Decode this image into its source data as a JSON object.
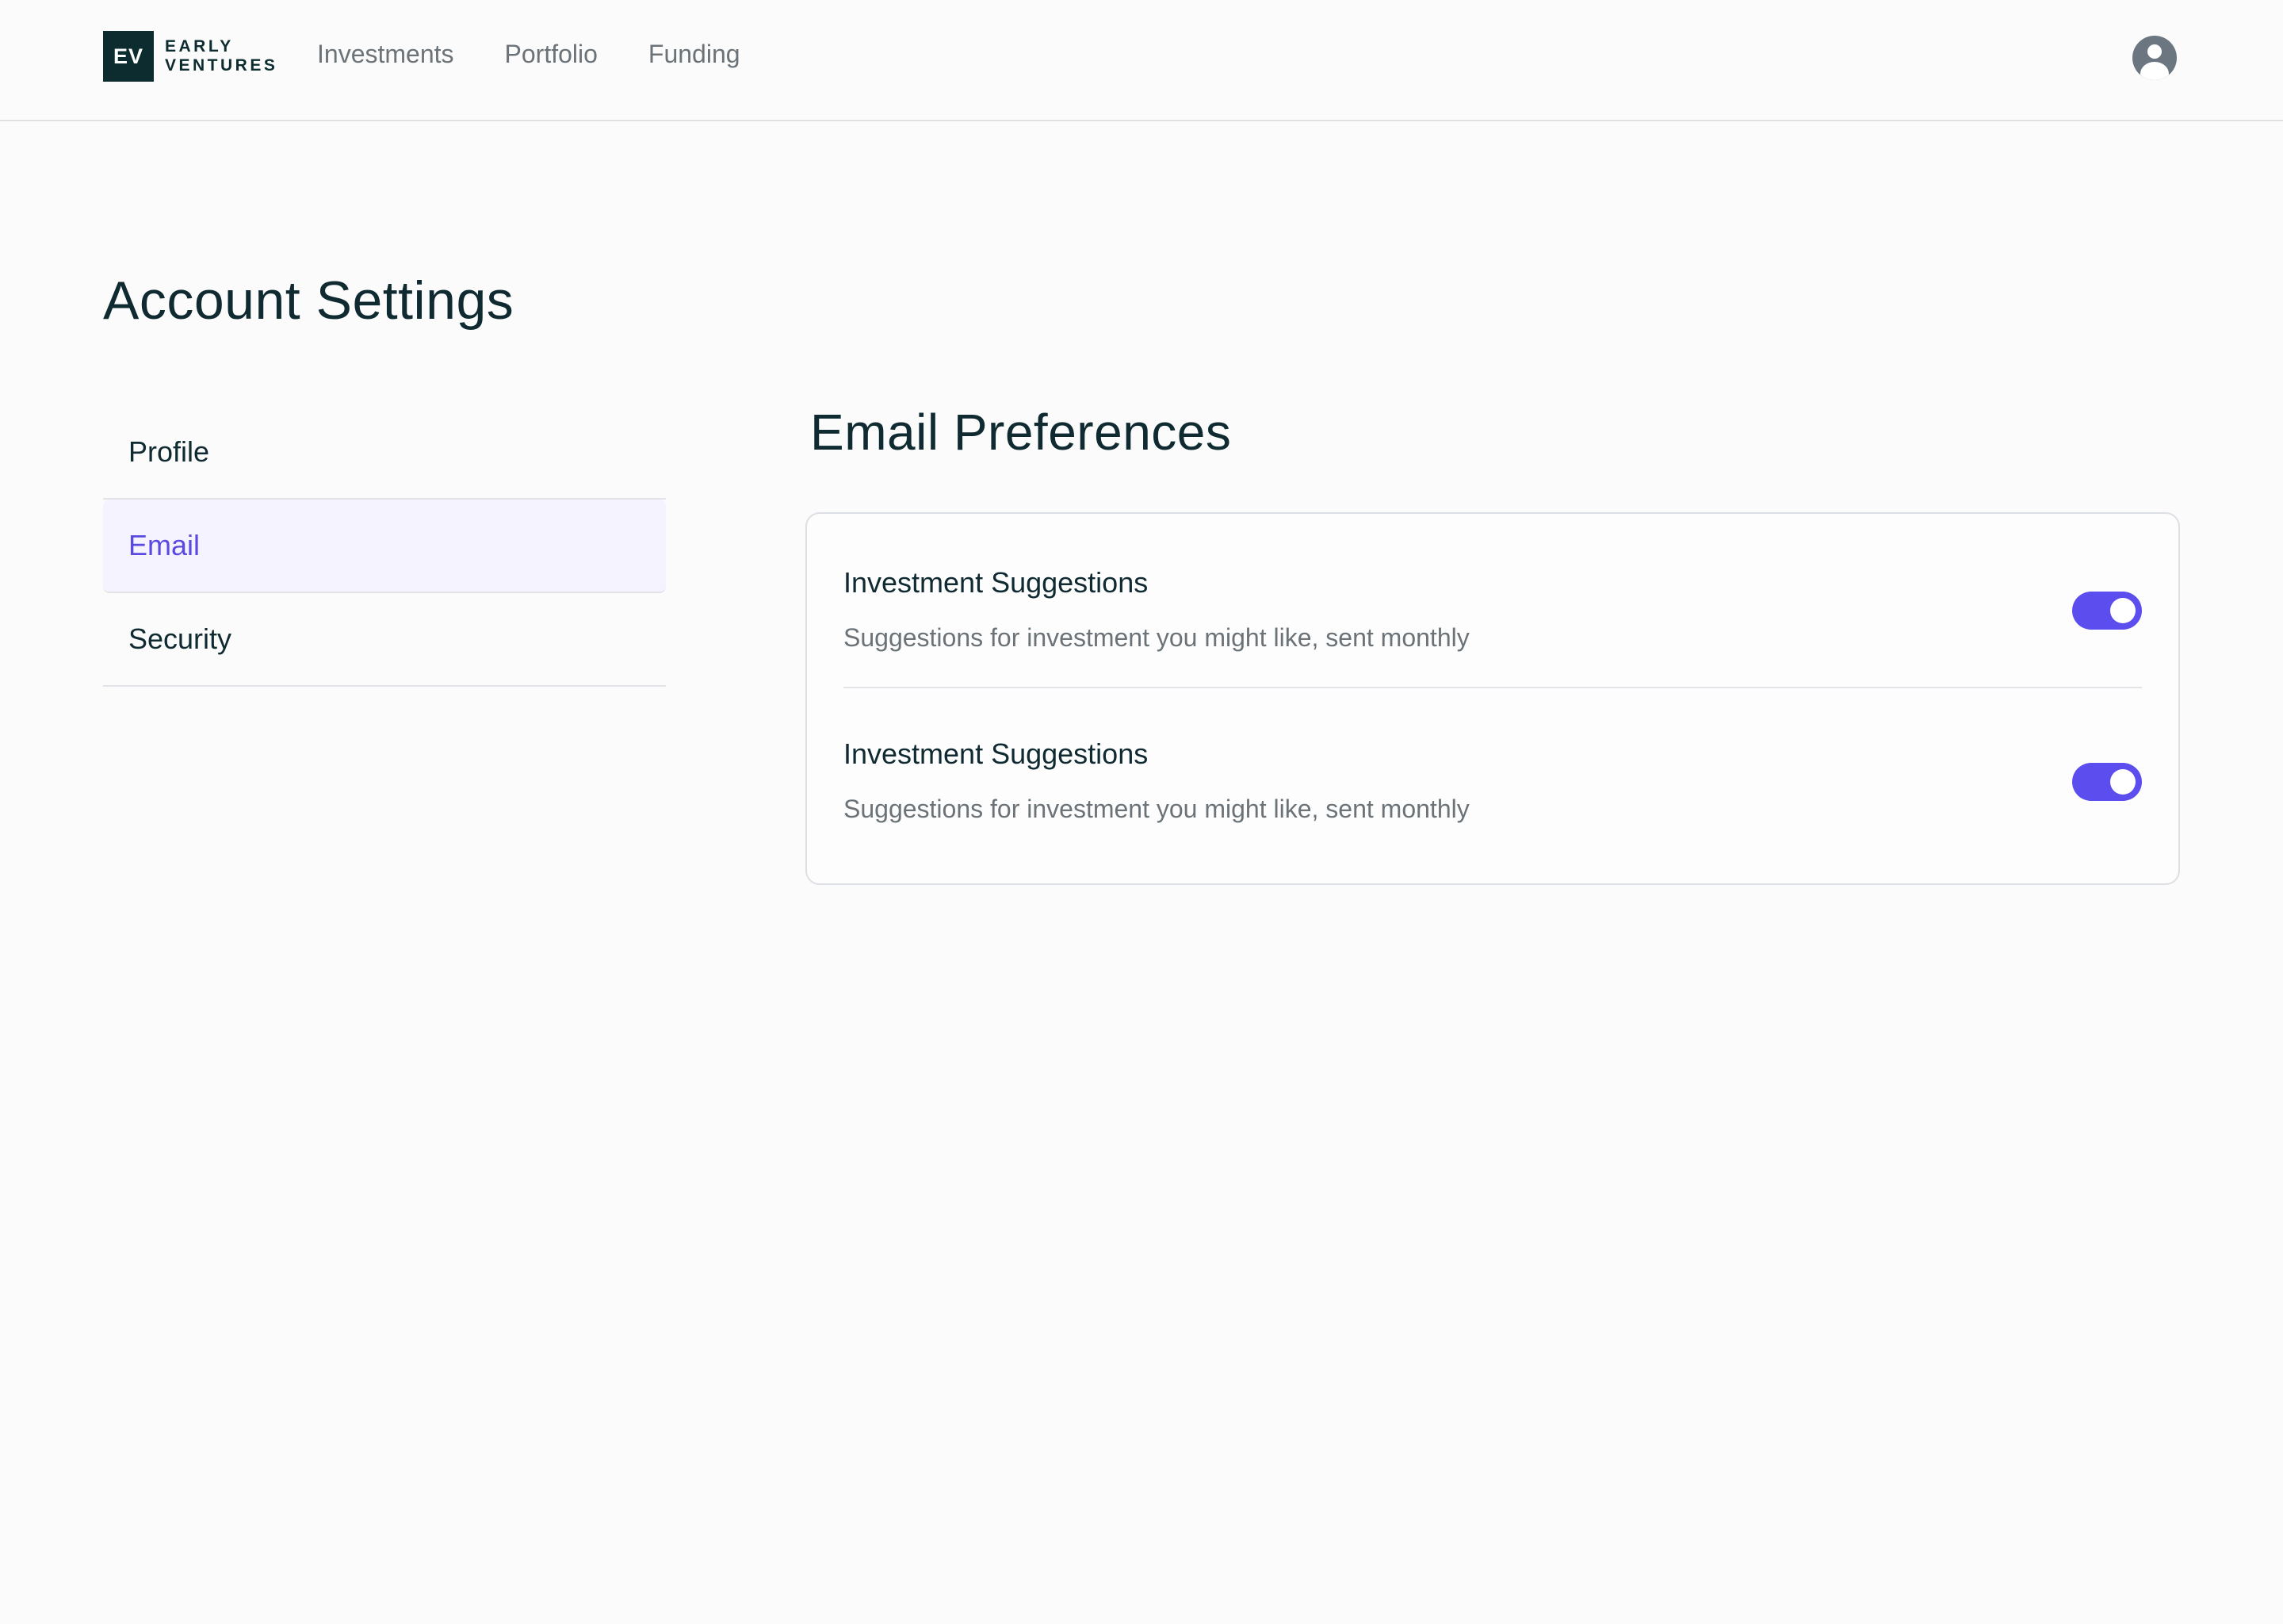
{
  "brand": {
    "mark": "EV",
    "line1": "EARLY",
    "line2": "VENTURES"
  },
  "nav": {
    "links": [
      {
        "label": "Investments"
      },
      {
        "label": "Portfolio"
      },
      {
        "label": "Funding"
      }
    ],
    "avatar_icon": "user-circle-icon"
  },
  "page": {
    "title": "Account Settings"
  },
  "side_menu": {
    "items": [
      {
        "label": "Profile",
        "active": false
      },
      {
        "label": "Email",
        "active": true
      },
      {
        "label": "Security",
        "active": false
      }
    ]
  },
  "email_preferences": {
    "title": "Email Preferences",
    "items": [
      {
        "title": "Investment Suggestions",
        "description": "Suggestions for investment you might like, sent monthly",
        "enabled": true
      },
      {
        "title": "Investment Suggestions",
        "description": "Suggestions for investment you might like, sent monthly",
        "enabled": true
      }
    ]
  },
  "colors": {
    "accent": "#5b4dee",
    "active_text": "#5a4ae0",
    "active_bg": "#f4f3ff",
    "brand_dark": "#0c2c30"
  }
}
